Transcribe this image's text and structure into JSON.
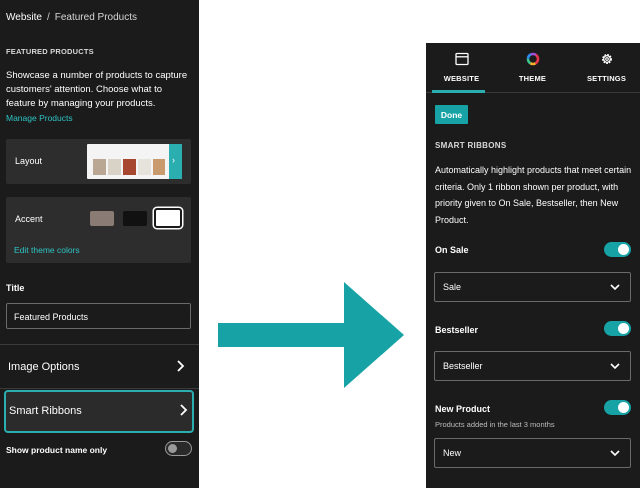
{
  "left_panel": {
    "breadcrumb": {
      "root": "Website",
      "separator": "/",
      "current": "Featured Products"
    },
    "section_caption": "FEATURED PRODUCTS",
    "description": "Showcase a number of products to capture customers' attention. Choose what to feature by managing your products.",
    "manage_link": "Manage Products",
    "layout_label": "Layout",
    "accent_label": "Accent",
    "accent_swatches": [
      "#8a7b74",
      "#111111",
      "#ffffff"
    ],
    "edit_colors_link": "Edit theme colors",
    "title_label": "Title",
    "title_value": "Featured Products",
    "image_options": "Image Options",
    "smart_ribbons": "Smart Ribbons",
    "show_name_only": "Show product name only",
    "show_name_only_on": false
  },
  "right_panel": {
    "tabs": [
      {
        "label": "WEBSITE",
        "icon": "browser-window-icon",
        "active": true
      },
      {
        "label": "THEME",
        "icon": "color-wheel-icon",
        "active": false
      },
      {
        "label": "SETTINGS",
        "icon": "gear-icon",
        "active": false
      }
    ],
    "done_label": "Done",
    "section_caption": "SMART RIBBONS",
    "description": "Automatically highlight products that meet certain criteria. Only 1 ribbon shown per product, with priority given to On Sale, Bestseller, then New Product.",
    "options": [
      {
        "label": "On Sale",
        "sublabel": "",
        "enabled": true,
        "select_value": "Sale"
      },
      {
        "label": "Bestseller",
        "sublabel": "",
        "enabled": true,
        "select_value": "Bestseller"
      },
      {
        "label": "New Product",
        "sublabel": "Products added in the last 3 months",
        "enabled": true,
        "select_value": "New"
      }
    ]
  },
  "colors": {
    "accent": "#2aaeb0",
    "panel_bg": "#1b1b1b",
    "card_bg": "#2d2d2d"
  }
}
